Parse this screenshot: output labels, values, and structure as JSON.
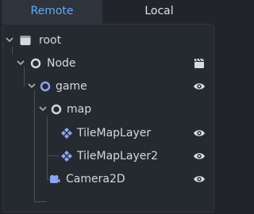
{
  "tabs": {
    "remote": "Remote",
    "local": "Local"
  },
  "tree": {
    "root": "root",
    "node": "Node",
    "game": "game",
    "map": "map",
    "tilemap1": "TileMapLayer",
    "tilemap2": "TileMapLayer2",
    "camera": "Camera2D"
  },
  "colors": {
    "accent": "#67a8f2",
    "node_icon": "#d6d9df",
    "node2d_icon": "#8da5f3",
    "eye_icon": "#d8dbe1"
  },
  "icons": {
    "root": "scene-root-icon",
    "node": "node-icon",
    "game": "node2d-icon",
    "map": "node-icon",
    "tilemap": "tilemap-icon",
    "camera": "camera2d-icon",
    "visibility": "eye-icon",
    "clapper": "clapperboard-icon"
  }
}
